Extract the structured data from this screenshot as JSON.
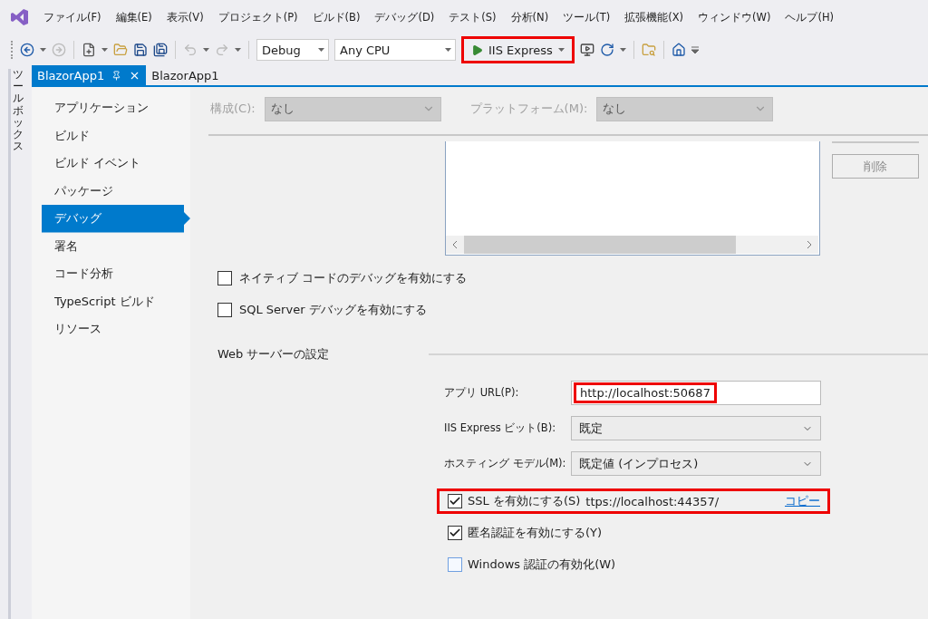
{
  "menu_bar": [
    "ファイル(F)",
    "編集(E)",
    "表示(V)",
    "プロジェクト(P)",
    "ビルド(B)",
    "デバッグ(D)",
    "テスト(S)",
    "分析(N)",
    "ツール(T)",
    "拡張機能(X)",
    "ウィンドウ(W)",
    "ヘルプ(H)"
  ],
  "toolbar": {
    "configuration": "Debug",
    "platform": "Any CPU",
    "run_button": {
      "label": "IIS Express",
      "highlighted": true
    }
  },
  "side_tab": "ツールボックス",
  "tabs": [
    {
      "label": "BlazorApp1",
      "selected": true
    },
    {
      "label": "BlazorApp1",
      "selected": false
    }
  ],
  "nav": [
    {
      "label": "アプリケーション",
      "selected": false
    },
    {
      "label": "ビルド",
      "selected": false
    },
    {
      "label": "ビルド イベント",
      "selected": false
    },
    {
      "label": "パッケージ",
      "selected": false
    },
    {
      "label": "デバッグ",
      "selected": true
    },
    {
      "label": "署名",
      "selected": false
    },
    {
      "label": "コード分析",
      "selected": false
    },
    {
      "label": "TypeScript ビルド",
      "selected": false
    },
    {
      "label": "リソース",
      "selected": false
    }
  ],
  "filter": {
    "configuration_label": "構成(C):",
    "configuration_value": "なし",
    "platform_label": "プラットフォーム(M):",
    "platform_value": "なし",
    "disabled": true
  },
  "list_panel": {
    "delete_button": "削除"
  },
  "debug_options": [
    {
      "label": "ネイティブ コードのデバッグを有効にする",
      "checked": false
    },
    {
      "label": "SQL Server デバッグを有効にする",
      "checked": false
    }
  ],
  "web_server": {
    "title": "Web サーバーの設定",
    "fields": [
      {
        "kind": "input",
        "label": "アプリ URL(P):",
        "value": "http://localhost:50687",
        "highlighted": true
      },
      {
        "kind": "select",
        "label": "IIS Express ビット(B):",
        "value": "既定",
        "highlighted": false
      },
      {
        "kind": "select",
        "label": "ホスティング モデル(M):",
        "value": "既定値 (インプロセス)",
        "highlighted": false
      }
    ],
    "options": [
      {
        "label": "SSL を有効にする(S)",
        "checked": true,
        "highlighted": true,
        "url": "ttps://localhost:44357/",
        "link": "コピー"
      },
      {
        "label": "匿名認証を有効にする(Y)",
        "checked": true,
        "highlighted": false
      },
      {
        "label": "Windows 認証の有効化(W)",
        "checked": false,
        "highlighted": false
      }
    ]
  }
}
